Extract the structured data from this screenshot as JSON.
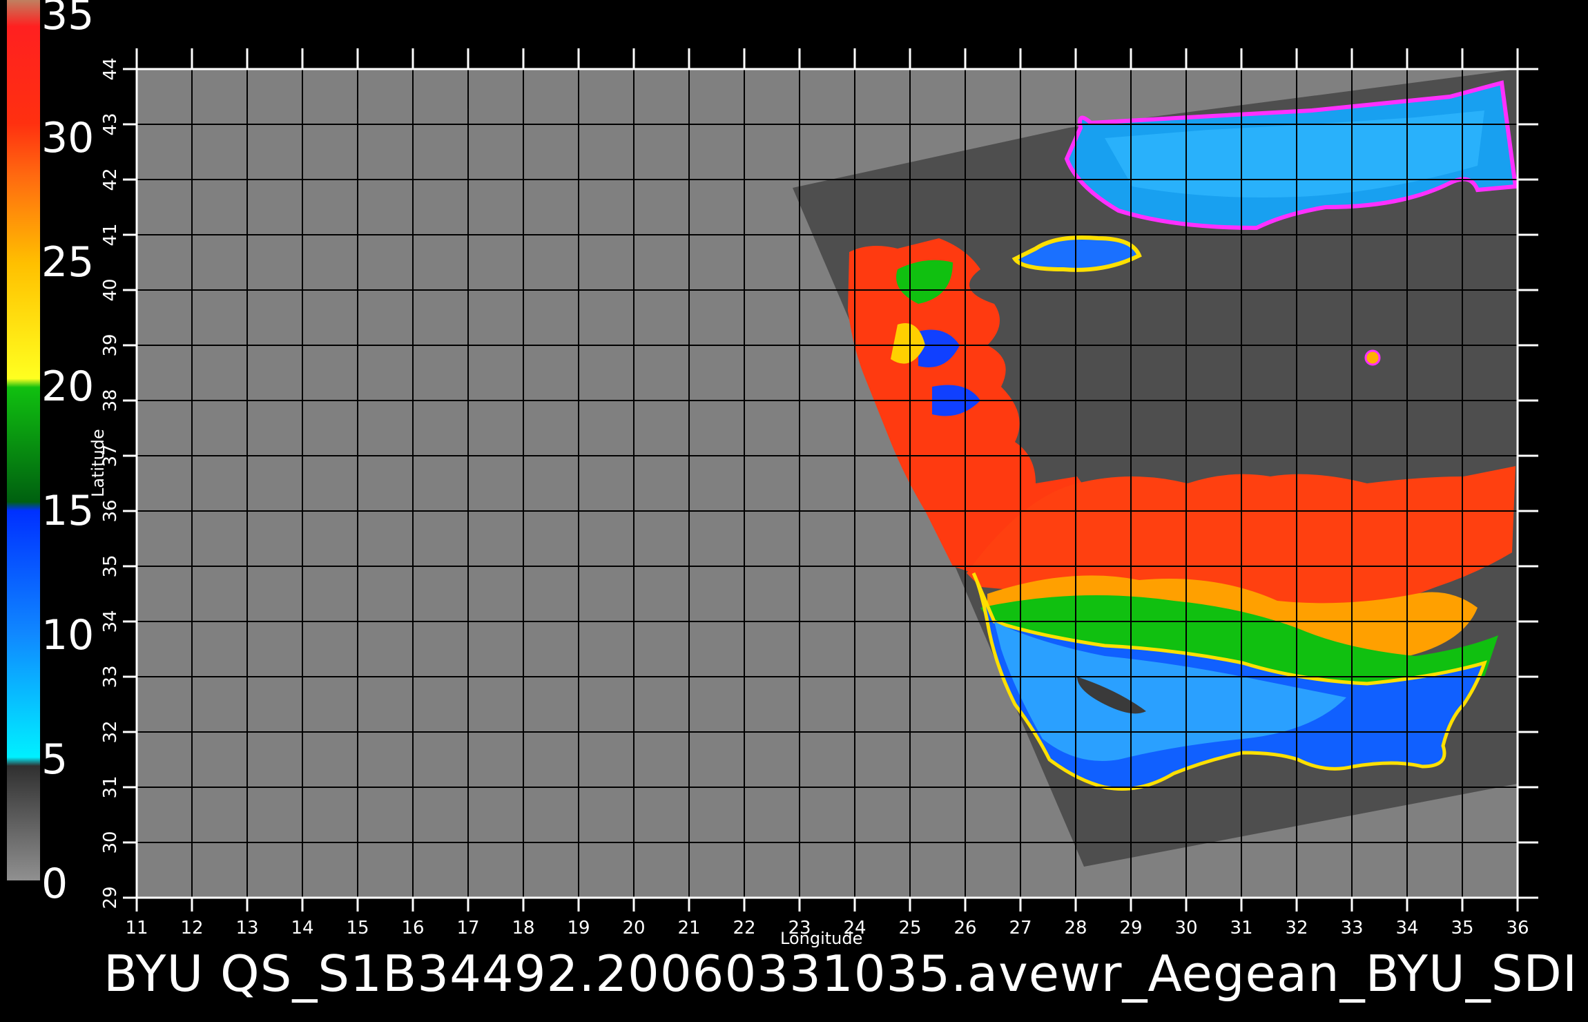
{
  "colorbar": {
    "labels": [
      "35",
      "30",
      "25",
      "20",
      "15",
      "10",
      "5",
      "0"
    ],
    "segments": [
      "#c08060",
      "#ff2a2a",
      "#ff6a18",
      "#ffb000",
      "#ffe000",
      "#10c010",
      "#0030ff",
      "#00e8ff",
      "#808080"
    ]
  },
  "map": {
    "xlabel": "Longitude",
    "ylabel": "Latitude",
    "lon_ticks": [
      "11",
      "12",
      "13",
      "14",
      "15",
      "16",
      "17",
      "18",
      "19",
      "20",
      "21",
      "22",
      "23",
      "24",
      "25",
      "26",
      "27",
      "28",
      "29",
      "30",
      "31",
      "32",
      "33",
      "34",
      "35",
      "36"
    ],
    "lat_ticks": [
      "29",
      "30",
      "31",
      "32",
      "33",
      "34",
      "35",
      "36",
      "37",
      "38",
      "39",
      "40",
      "41",
      "42",
      "43",
      "44"
    ],
    "lon_range": [
      11,
      36
    ],
    "lat_range": [
      29,
      44
    ],
    "land_color": "#808080",
    "swath_color": "#4e4e4e"
  },
  "footer": {
    "title": "BYU  QS_S1B34492.20060331035.avewr_Aegean_BYU_SDI"
  }
}
